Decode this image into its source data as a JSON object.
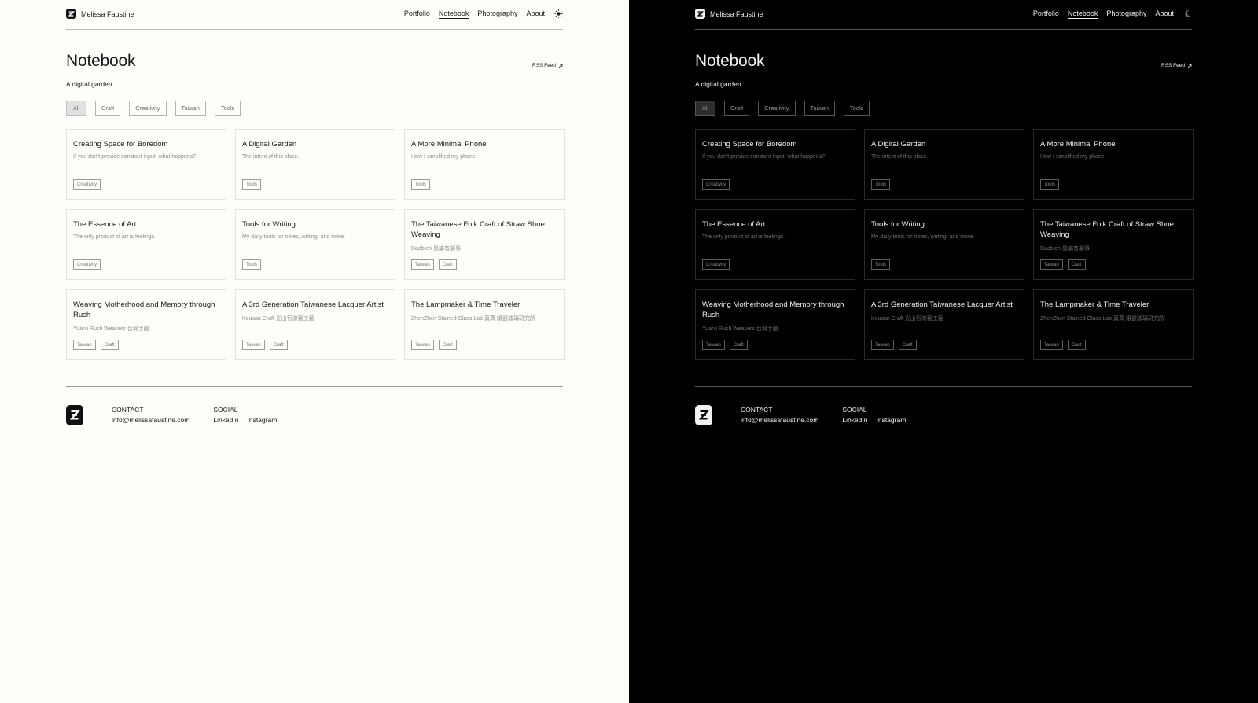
{
  "site": {
    "name": "Melissa Faustine"
  },
  "nav": [
    "Portfolio",
    "Notebook",
    "Photography",
    "About"
  ],
  "page": {
    "title": "Notebook",
    "subtitle": "A digital garden.",
    "rss": "RSS Feed"
  },
  "filters": [
    "All",
    "Craft",
    "Creativity",
    "Taiwan",
    "Tools"
  ],
  "cards": [
    {
      "title": "Creating Space for Boredom",
      "desc": "If you don’t provide constant input, what happens?",
      "tags": [
        "Creativity"
      ]
    },
    {
      "title": "A Digital Garden",
      "desc": "The intent of this place.",
      "tags": [
        "Tools"
      ]
    },
    {
      "title": "A More Minimal Phone",
      "desc": "How I simplified my phone.",
      "tags": [
        "Tools"
      ]
    },
    {
      "title": "The Essence of Art",
      "desc": "The only product of art is feelings.",
      "tags": [
        "Creativity"
      ]
    },
    {
      "title": "Tools for Writing",
      "desc": "My daily tools for notes, writing, and more.",
      "tags": [
        "Tools"
      ]
    },
    {
      "title": "The Taiwanese Folk Craft of Straw Shoe Weaving",
      "desc": "Daobien 島編有凝事",
      "tags": [
        "Taiwan",
        "Craft"
      ]
    },
    {
      "title": "Weaving Motherhood and Memory through Rush",
      "desc": "Yuanli Rush Weavers 台灣手藺",
      "tags": [
        "Taiwan",
        "Craft"
      ]
    },
    {
      "title": "A 3rd Generation Taiwanese Lacquer Artist",
      "desc": "Kousan Craft 光山行漆藝工藝",
      "tags": [
        "Taiwan",
        "Craft"
      ]
    },
    {
      "title": "The Lampmaker & Time Traveler",
      "desc": "ZhenZhen Stained Glass Lab 真真 鑲嵌玻璃研究所",
      "tags": [
        "Taiwan",
        "Craft"
      ]
    }
  ],
  "footer": {
    "contact_label": "CONTACT",
    "email": "info@melissafaustine.com",
    "social_label": "SOCIAL",
    "social_links": [
      "LinkedIn",
      "Instagram"
    ]
  },
  "colors": {
    "light_bg": "#fefdfa",
    "dark_bg": "#000000"
  },
  "icons": {
    "light_theme": "sun-icon",
    "dark_theme": "moon-icon",
    "rss": "arrow-up-right-icon"
  }
}
